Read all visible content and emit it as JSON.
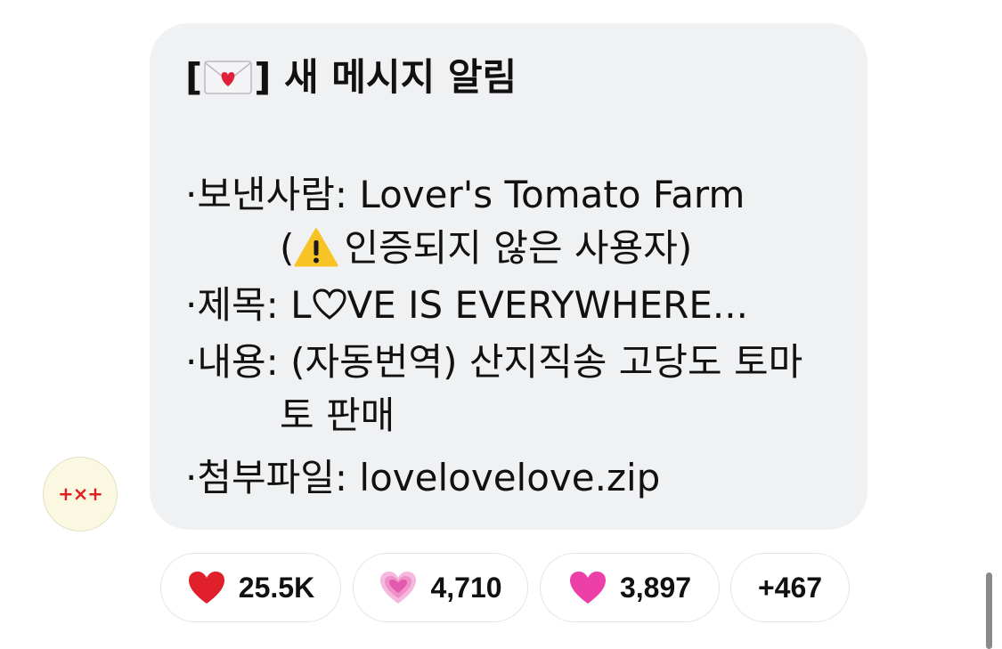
{
  "sender": {
    "avatar_text": "+×+"
  },
  "message": {
    "title_open": "[",
    "title_close": "] 새 메시지 알림",
    "sender_label": "·보낸사람: Lover's Tomato Farm",
    "warning_open": "(",
    "warning_text": "인증되지 않은 사용자)",
    "subject_prefix": "·제목: L",
    "subject_suffix": "VE IS EVERYWHERE...",
    "content_line1": "·내용: (자동번역) 산지직송 고당도 토마",
    "content_line2": "토 판매",
    "attachment_line": "·첨부파일: lovelovelove.zip"
  },
  "icons": {
    "envelope": "love-letter-icon",
    "warning": "warning-icon",
    "heart_outline": "white-heart-icon"
  },
  "reactions": [
    {
      "icon": "red-heart-icon",
      "count": "25.5K",
      "color": "#e0202a"
    },
    {
      "icon": "growing-heart-icon",
      "count": "4,710",
      "color": "#f08fc8"
    },
    {
      "icon": "pink-heart-icon",
      "count": "3,897",
      "color": "#ec3fa8"
    },
    {
      "icon": "",
      "count": "+467",
      "color": ""
    }
  ],
  "colors": {
    "bubble": "#f0f1f3",
    "avatar_bg": "#fbf8e2",
    "avatar_logo": "#e02020"
  }
}
